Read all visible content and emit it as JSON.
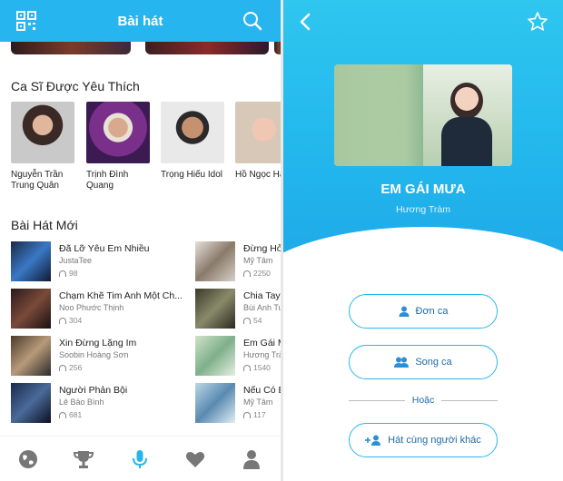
{
  "left": {
    "header": {
      "title": "Bài hát"
    },
    "singers_title": "Ca Sĩ Được Yêu Thích",
    "singers": [
      {
        "name": "Nguyễn Trần Trung Quân"
      },
      {
        "name": "Trịnh Đình Quang"
      },
      {
        "name": "Trọng Hiếu Idol"
      },
      {
        "name": "Hồ Ngọc Hà"
      }
    ],
    "new_songs_title": "Bài Hát Mới",
    "songs_col1": [
      {
        "title": "Đã Lỡ Yêu Em Nhiều",
        "artist": "JustaTee",
        "plays": "98"
      },
      {
        "title": "Chạm Khẽ Tim Anh Một Ch...",
        "artist": "Noo Phước Thịnh",
        "plays": "304"
      },
      {
        "title": "Xin Đừng Lặng Im",
        "artist": "Soobin Hoàng Sơn",
        "plays": "256"
      },
      {
        "title": "Người Phản Bội",
        "artist": "Lê Bảo Bình",
        "plays": "681"
      }
    ],
    "songs_col2": [
      {
        "title": "Đừng Hỏi",
        "artist": "Mỹ Tâm",
        "plays": "2250"
      },
      {
        "title": "Chia Tay",
        "artist": "Bùi Anh Tuấn",
        "plays": "54"
      },
      {
        "title": "Em Gái Mưa",
        "artist": "Hương Tràm",
        "plays": "1540"
      },
      {
        "title": "Nếu Có Bi",
        "artist": "Mỹ Tâm",
        "plays": "117"
      }
    ]
  },
  "right": {
    "song_title": "EM GÁI MƯA",
    "artist": "Hương Tràm",
    "buttons": {
      "solo": "Đơn ca",
      "duet": "Song ca",
      "or": "Hoặc",
      "with_others": "Hát cùng người khác"
    }
  },
  "colors": {
    "accent": "#27b5f0",
    "button_text": "#1d6aa8"
  }
}
